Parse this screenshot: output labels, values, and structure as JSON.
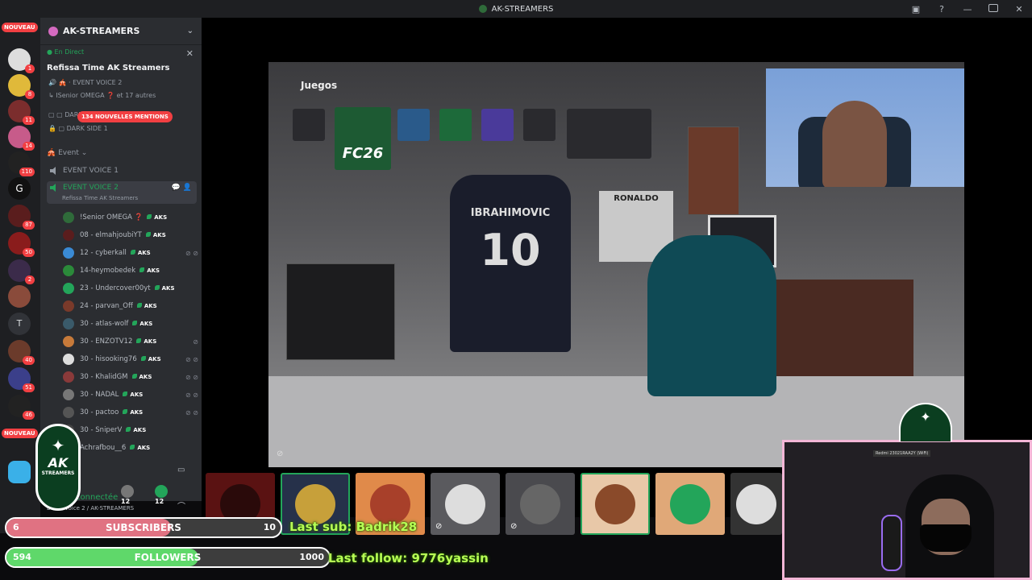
{
  "window": {
    "title": "AK-STREAMERS"
  },
  "server_rail": {
    "new_label": "NOUVEAU",
    "badges": [
      "1",
      "8",
      "11",
      "14",
      "110",
      "87",
      "50",
      "2",
      "40",
      "51",
      "46"
    ],
    "text_server": "T",
    "gaming_label": "G"
  },
  "channel_panel": {
    "server_name": "AK-STREAMERS",
    "live_label": "En Direct",
    "live_title": "Refissa Time AK Streamers",
    "live_sub1": "EVENT VOICE 2",
    "live_sub2": "ISenior OMEGA ❓ et 17 autres",
    "mentions_badge": "134 NOUVELLES MENTIONS",
    "dark_side": "DARK SIDE 1",
    "category": "Event",
    "voice1": "EVENT VOICE 1",
    "voice2": "EVENT VOICE 2",
    "voice2_sub": "Refissa Time AK Streamers",
    "members": [
      {
        "name": "!Senior OMEGA ❓",
        "tag": "AKS"
      },
      {
        "name": "08 - elmahjoubiYT",
        "tag": "AKS"
      },
      {
        "name": "12 - cyberkall",
        "tag": "AKS"
      },
      {
        "name": "14-heymobedek",
        "tag": "AKS"
      },
      {
        "name": "23 - Undercover00yt",
        "tag": "AKS"
      },
      {
        "name": "24 - parvan_Off",
        "tag": "AKS"
      },
      {
        "name": "30 - atlas-wolf",
        "tag": "AKS"
      },
      {
        "name": "30 - ENZOTV12",
        "tag": "AKS"
      },
      {
        "name": "30 - hisooking76",
        "tag": "AKS"
      },
      {
        "name": "30 - KhalidGM",
        "tag": "AKS"
      },
      {
        "name": "30 - NADAL",
        "tag": "AKS"
      },
      {
        "name": "30 - pactoo",
        "tag": "AKS"
      },
      {
        "name": "30 - SniperV",
        "tag": "AKS"
      },
      {
        "name": "Achrafbou__6",
        "tag": "AKS"
      }
    ],
    "voice_connected": "Voix connectée",
    "voice_connected_sub": "Event Voice 2 / AK-STREAMERS",
    "user_num1": "12",
    "user_num2": "12"
  },
  "stream": {
    "menu_label": "Juegos",
    "tile_label": "FC26",
    "jersey_name": "IBRAHIMOVIC",
    "jersey_number": "10",
    "poster_label": "RONALDO"
  },
  "overlay": {
    "subscribers": {
      "label": "SUBSCRIBERS",
      "current": "6",
      "goal": "10",
      "progress": 0.6
    },
    "followers": {
      "label": "FOLLOWERS",
      "current": "594",
      "goal": "1000",
      "progress": 0.594
    },
    "last_sub": "Last sub: Badrik28",
    "last_follow": "Last follow: 9776yassin",
    "logo_text": "AK",
    "logo_sub": "STREAMERS",
    "cam_label": "Redmi 23021RAA2Y (WiFi)"
  },
  "colors": {
    "accent_green": "#23a55a",
    "alert_red": "#f23f42",
    "sub_bar": "#f07a8a",
    "follow_bar": "#5fd86a"
  }
}
